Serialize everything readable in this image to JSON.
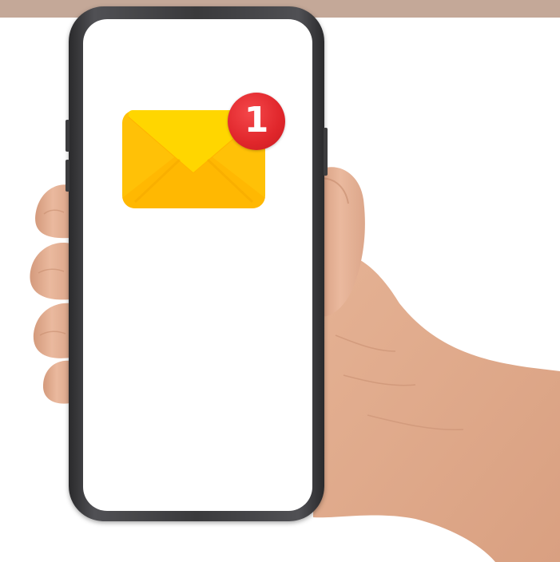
{
  "notification": {
    "icon": "envelope-icon",
    "badge_count": "1"
  },
  "colors": {
    "top_band": "#c4a898",
    "envelope": "#ffc107",
    "envelope_flap": "#ffd600",
    "badge": "#e0262b",
    "phone_frame": "#3a3a3c",
    "screen": "#ffffff",
    "skin": "#e8b898"
  }
}
